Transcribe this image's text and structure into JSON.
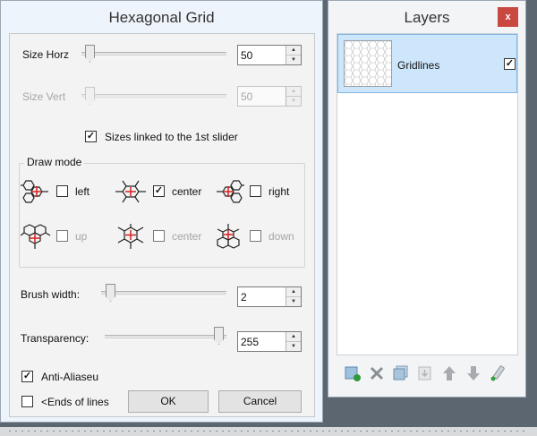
{
  "hex_dialog": {
    "title": "Hexagonal Grid",
    "size_horz": {
      "label": "Size Horz",
      "value": "50",
      "level": 0.0
    },
    "size_vert": {
      "label": "Size Vert",
      "value": "50",
      "level": 0.0
    },
    "linked_checkbox": {
      "label": "Sizes linked to the 1st slider",
      "checked": true
    },
    "draw_mode": {
      "label": "Draw mode",
      "options": [
        {
          "label": "left",
          "checked": false,
          "enabled": true
        },
        {
          "label": "center",
          "checked": true,
          "enabled": true
        },
        {
          "label": "right",
          "checked": false,
          "enabled": true
        },
        {
          "label": "up",
          "checked": false,
          "enabled": false
        },
        {
          "label": "center",
          "checked": false,
          "enabled": false
        },
        {
          "label": "down",
          "checked": false,
          "enabled": false
        }
      ]
    },
    "brush_width": {
      "label": "Brush width:",
      "value": "2",
      "level": 0.0
    },
    "transparency": {
      "label": "Transparency:",
      "value": "255",
      "level": 1.0
    },
    "anti_alias": {
      "label": "Anti-Aliaseu",
      "checked": true
    },
    "ends_of_lines": {
      "label": "<Ends of lines",
      "checked": false
    },
    "ok_label": "OK",
    "cancel_label": "Cancel"
  },
  "layers_panel": {
    "title": "Layers",
    "close_label": "x",
    "layers": [
      {
        "name": "Gridlines",
        "visible": true,
        "selected": true
      }
    ],
    "toolbar_icons": [
      "add-layer-icon",
      "delete-layer-icon",
      "duplicate-layer-icon",
      "merge-layer-down-icon",
      "move-layer-up-icon",
      "move-layer-down-icon",
      "layer-properties-icon"
    ]
  },
  "colors": {
    "selection": "#cde6fb",
    "close_button": "#c9483f",
    "hex_center_mark": "#d42020"
  }
}
